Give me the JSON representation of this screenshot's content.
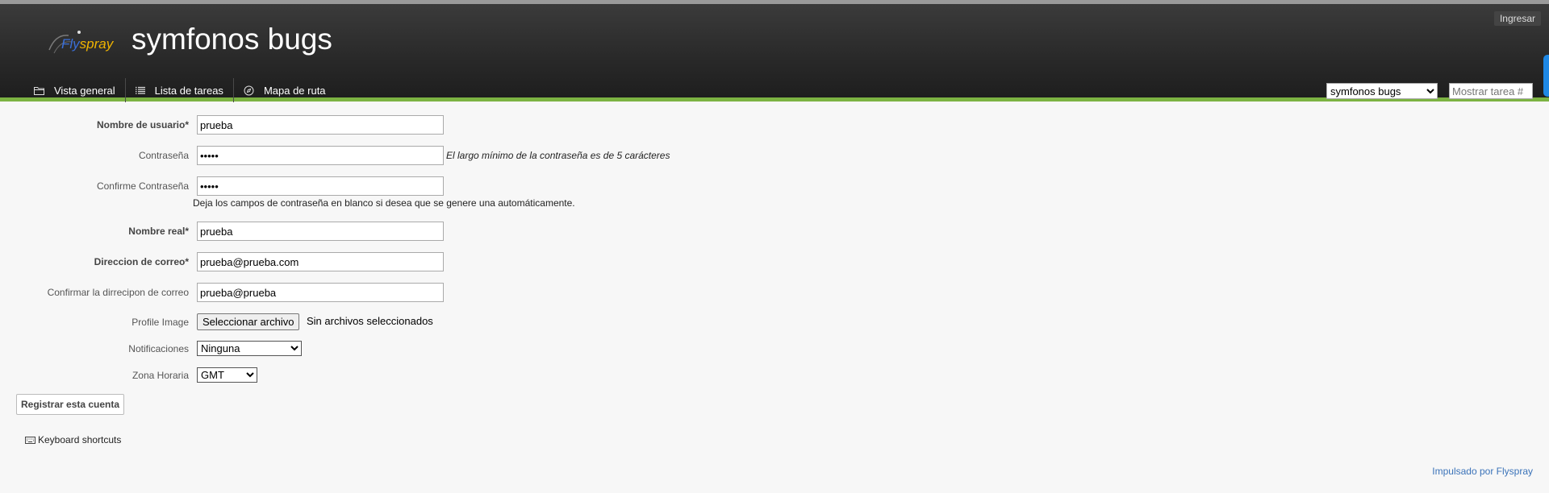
{
  "header": {
    "logo_text": "Flyspray",
    "site_title": "symfonos bugs",
    "login_label": "Ingresar"
  },
  "nav": {
    "items": [
      {
        "label": "Vista general",
        "icon": "folder-icon"
      },
      {
        "label": "Lista de tareas",
        "icon": "list-icon"
      },
      {
        "label": "Mapa de ruta",
        "icon": "compass-icon"
      }
    ],
    "project_selected": "symfonos bugs",
    "task_placeholder": "Mostrar tarea #"
  },
  "form": {
    "username": {
      "label": "Nombre de usuario*",
      "value": "prueba"
    },
    "password": {
      "label": "Contraseña",
      "value": "prueb",
      "hint": "El largo mínimo de la contraseña es de 5 carácteres"
    },
    "confirm_password": {
      "label": "Confirme Contraseña",
      "value": "prueb"
    },
    "blank_note": "Deja los campos de contraseña en blanco si desea que se genere una automáticamente.",
    "real_name": {
      "label": "Nombre real*",
      "value": "prueba"
    },
    "email": {
      "label": "Direccion de correo*",
      "value": "prueba@prueba.com"
    },
    "confirm_email": {
      "label": "Confirmar la dirrecipon de correo",
      "value": "prueba@prueba"
    },
    "profile_image": {
      "label": "Profile Image",
      "button_label": "Seleccionar archivo",
      "status": "Sin archivos seleccionados"
    },
    "notifications": {
      "label": "Notificaciones",
      "selected": "Ninguna"
    },
    "timezone": {
      "label": "Zona Horaria",
      "selected": "GMT"
    },
    "submit_label": "Registrar esta cuenta"
  },
  "footer": {
    "shortcuts_label": "Keyboard shortcuts",
    "powered_by": "Impulsado por Flyspray"
  },
  "colors": {
    "header_bg": "#2a2a2a",
    "accent_green": "#7cb342",
    "link_blue": "#3b73b9",
    "side_tab_blue": "#1e88e5"
  }
}
